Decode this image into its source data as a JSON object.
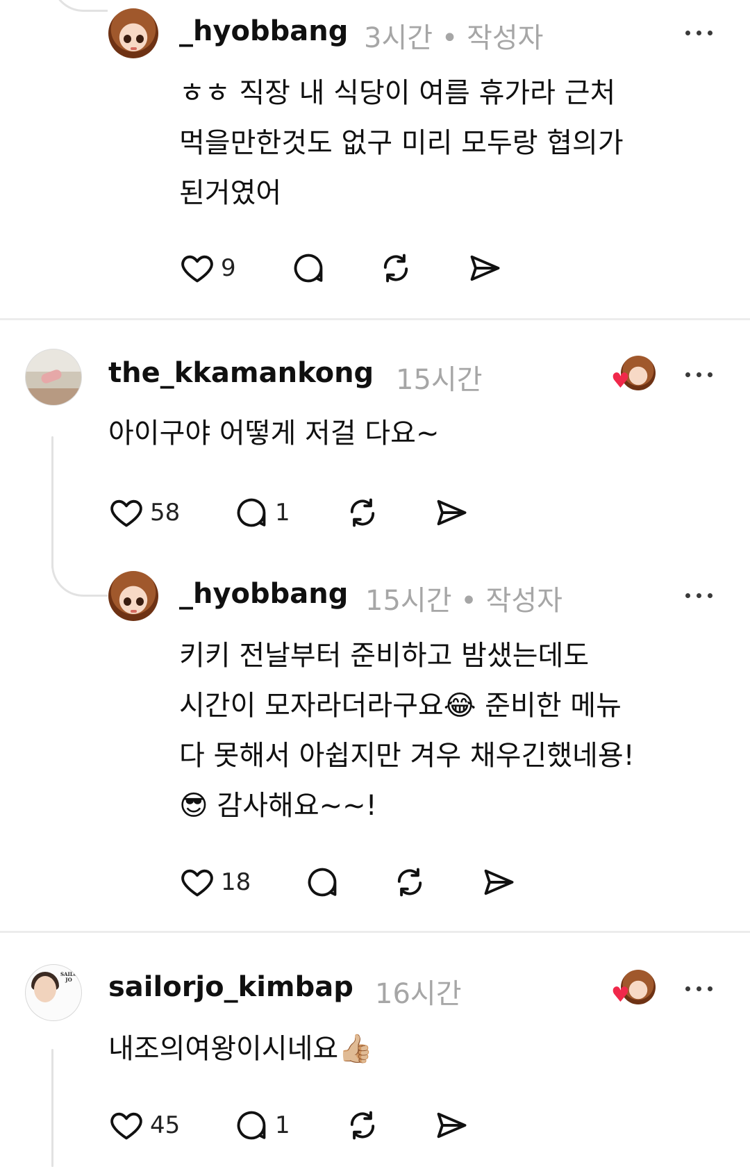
{
  "posts": [
    {
      "username": "_hyobbang",
      "meta": "3시간 • 작성자",
      "lines": [
        "ㅎㅎ 직장 내 식당이 여름 휴가라 근처",
        "먹을만한것도 없구 미리 모두랑 협의가",
        "된거였어"
      ],
      "likes": "9",
      "replies": "",
      "icons": [
        "heart-icon",
        "comment-icon",
        "repost-icon",
        "share-icon"
      ]
    },
    {
      "username": "the_kkamankong",
      "meta": "15시간",
      "lines": [
        "아이구야  어떻게  저걸 다요~"
      ],
      "likes": "58",
      "replies": "1",
      "author_liked": true
    },
    {
      "username": "_hyobbang",
      "meta": "15시간 • 작성자",
      "lines": [
        "키키 전날부터 준비하고 밤샜는데도",
        "시간이 모자라더라구요😂 준비한 메뉴",
        "다 못해서 아쉽지만 겨우 채우긴했네용!",
        "😎 감사해요~~!"
      ],
      "likes": "18",
      "replies": ""
    },
    {
      "username": "sailorjo_kimbap",
      "meta": "16시간",
      "lines": [
        "내조의여왕이시네요👍🏼"
      ],
      "likes": "45",
      "replies": "1",
      "author_liked": true
    }
  ],
  "avatar_logo_text": "SAILOR JO",
  "colors": {
    "text": "#101010",
    "meta": "#a6a6a6",
    "divider": "#ececec",
    "thread_line": "#e2e2e2",
    "like_heart": "#f0284a"
  }
}
